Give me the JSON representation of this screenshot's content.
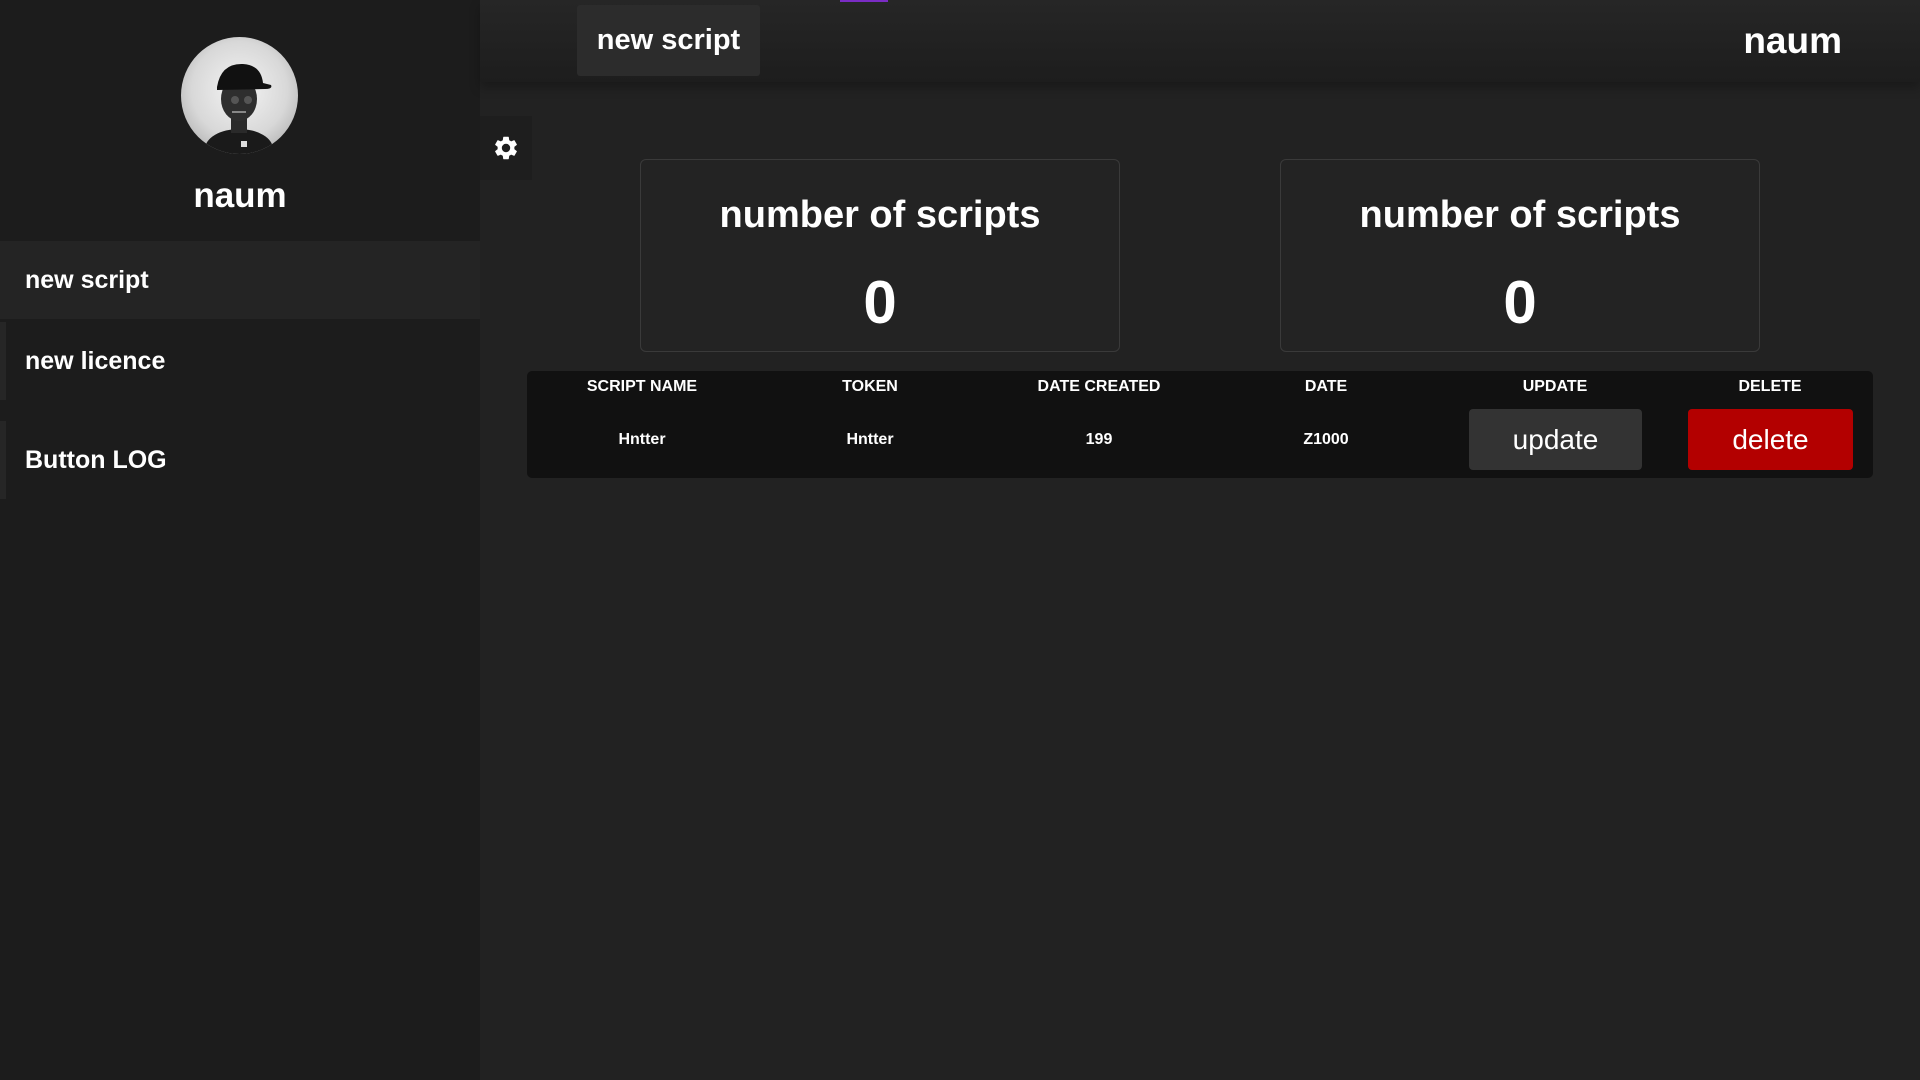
{
  "sidebar": {
    "profile_name": "naum",
    "items": [
      {
        "label": "new script"
      },
      {
        "label": "new licence"
      },
      {
        "label": "Button LOG"
      }
    ]
  },
  "header": {
    "button_label": "new script",
    "user_name": "naum"
  },
  "stats": [
    {
      "title": "number of scripts",
      "value": "0"
    },
    {
      "title": "number of scripts",
      "value": "0"
    }
  ],
  "table": {
    "headers": [
      "SCRIPT NAME",
      "TOKEN",
      "DATE CREATED",
      "DATE",
      "UPDATE",
      "DELETE"
    ],
    "rows": [
      {
        "script_name": "Hntter",
        "token": "Hntter",
        "date_created": "199",
        "date": "Z1000",
        "update_label": "update",
        "delete_label": "delete"
      }
    ]
  },
  "colors": {
    "background": "#222222",
    "sidebar": "#1c1c1c",
    "accent": "#7a2cc4",
    "delete": "#b30000"
  },
  "icons": {
    "settings": "gear-icon",
    "avatar": "avatar"
  }
}
